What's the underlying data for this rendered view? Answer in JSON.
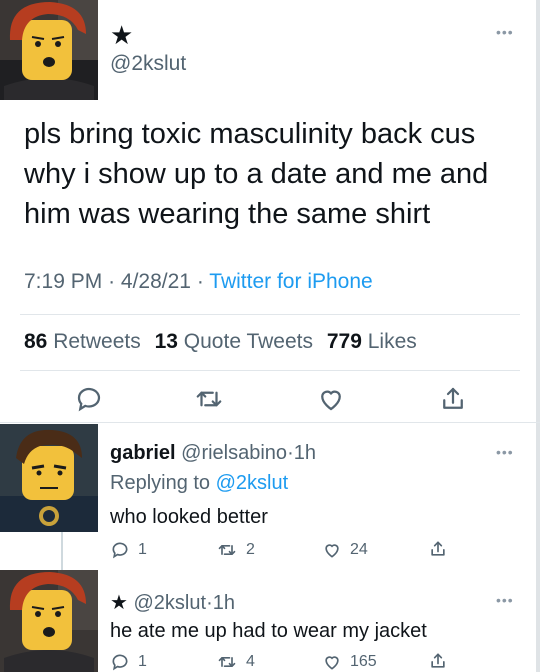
{
  "main_tweet": {
    "display_name": "★",
    "handle": "@2kslut",
    "text": "pls bring toxic masculinity back cus why i show up to a date and me and him was wearing the same shirt",
    "time": "7:19 PM",
    "date": "4/28/21",
    "source": "Twitter for iPhone",
    "retweets_count": "86",
    "retweets_label": "Retweets",
    "quotes_count": "13",
    "quotes_label": "Quote Tweets",
    "likes_count": "779",
    "likes_label": "Likes"
  },
  "reply1": {
    "display_name": "gabriel",
    "handle": "@rielsabino",
    "time": "1h",
    "replying_prefix": "Replying to",
    "replying_to": "@2kslut",
    "text": "who looked better",
    "reply_count": "1",
    "retweet_count": "2",
    "like_count": "24"
  },
  "reply2": {
    "display_name": "★",
    "handle": "@2kslut",
    "time": "1h",
    "text": "he ate me up had to wear my jacket",
    "reply_count": "1",
    "retweet_count": "4",
    "like_count": "165"
  },
  "separator_dot": "·",
  "more_glyph": "•••",
  "colors": {
    "link": "#1d9bf0",
    "muted": "#536471",
    "text": "#0f1419"
  },
  "icons": [
    "reply-icon",
    "retweet-icon",
    "like-icon",
    "share-icon",
    "more-icon"
  ]
}
